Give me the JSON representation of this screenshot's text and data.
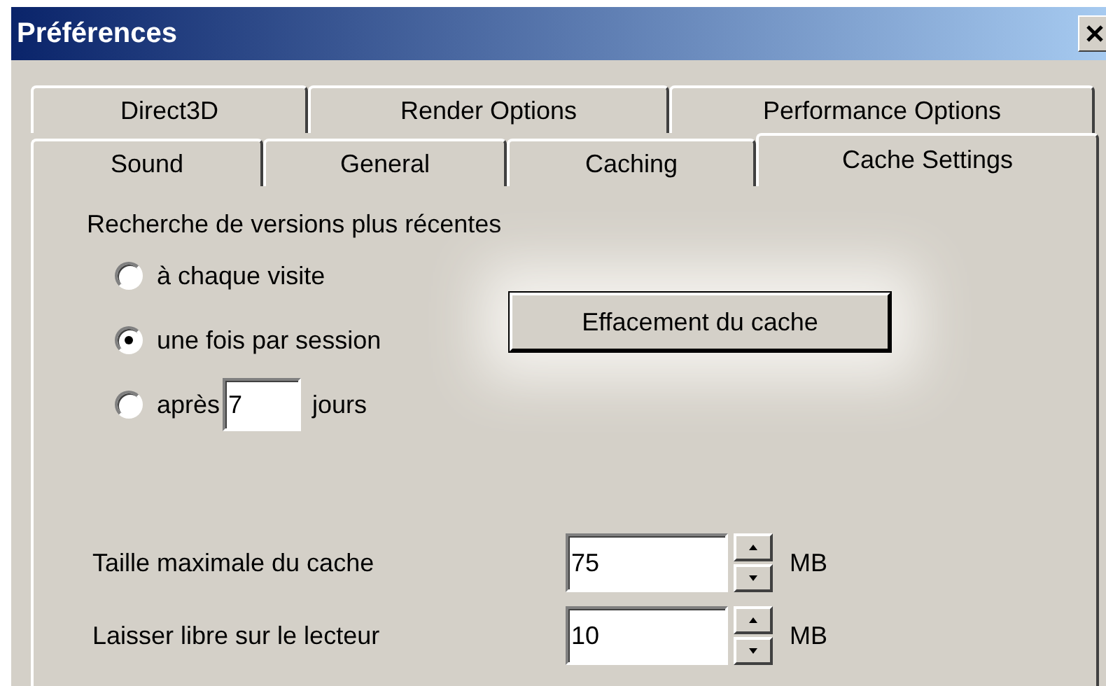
{
  "window": {
    "title": "Préférences"
  },
  "tab_rows": [
    {
      "tabs": [
        {
          "label": "Direct3D",
          "selected": false
        },
        {
          "label": "Render Options",
          "selected": false
        },
        {
          "label": "Performance Options",
          "selected": false
        }
      ]
    },
    {
      "tabs": [
        {
          "label": "Sound",
          "selected": false
        },
        {
          "label": "General",
          "selected": false
        },
        {
          "label": "Caching",
          "selected": false
        },
        {
          "label": "Cache Settings",
          "selected": true
        }
      ]
    }
  ],
  "update_check": {
    "label": "Recherche de versions plus récentes",
    "options": [
      {
        "kind": "plain",
        "label": "à chaque visite",
        "selected": false
      },
      {
        "kind": "plain",
        "label": "une fois par session",
        "selected": true
      },
      {
        "kind": "days",
        "label": "après",
        "value": "7",
        "suffix": "jours",
        "selected": false
      }
    ]
  },
  "clear_button": "Effacement du cache",
  "size_fields": [
    {
      "label": "Taille maximale du cache",
      "value": "75",
      "unit": "MB"
    },
    {
      "label": "Laisser libre sur le lecteur",
      "value": "10",
      "unit": "MB"
    }
  ]
}
